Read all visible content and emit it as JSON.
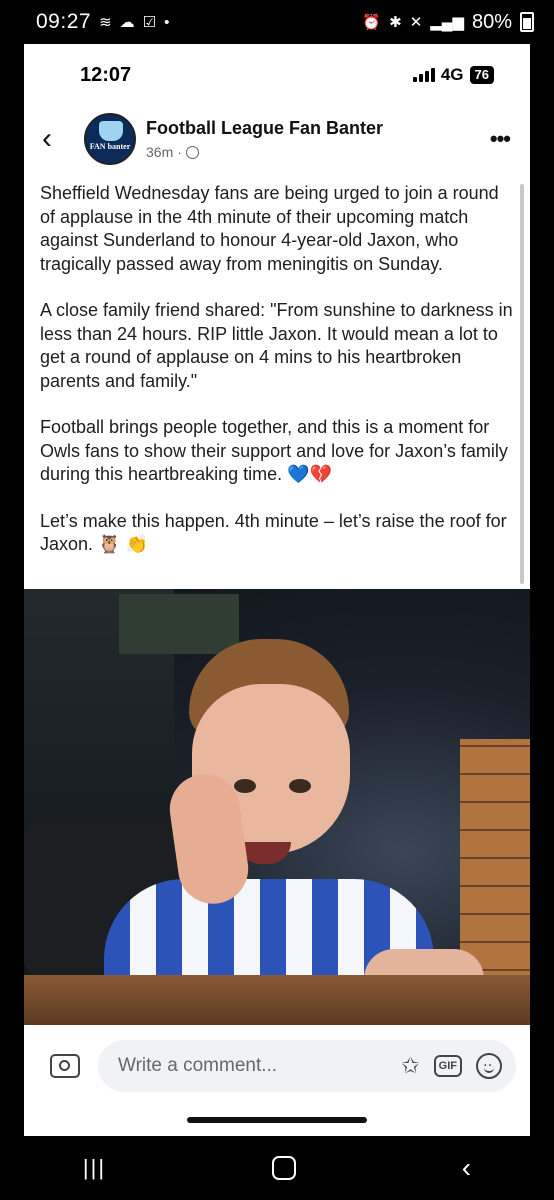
{
  "device_status": {
    "time": "09:27",
    "battery": "80%"
  },
  "inner_status": {
    "time": "12:07",
    "network": "4G",
    "battery": "76"
  },
  "post": {
    "page_name": "Football League Fan Banter",
    "time_ago": "36m",
    "separator": "·",
    "avatar_text": "FAN banter",
    "paragraphs": [
      "Sheffield Wednesday fans are being urged to join a round of applause in the 4th minute of their upcoming match against Sunderland to honour 4-year-old Jaxon, who tragically passed away from meningitis on Sunday.",
      "A close family friend shared: \"From sunshine to darkness in less than 24 hours. RIP little Jaxon. It would mean a lot to get a round of applause on 4 mins to his heartbroken parents and family.\"",
      "Football brings people together, and this is a moment for Owls fans to show their support and love for Jaxon’s family during this heartbreaking time. 💙💔",
      "Let’s make this happen. 4th minute – let’s raise the roof for Jaxon. 🦉 👏"
    ]
  },
  "comment_bar": {
    "placeholder": "Write a comment...",
    "gif_label": "GIF"
  },
  "icons": {
    "back": "chevron-left-icon",
    "more": "more-dots-icon",
    "camera": "camera-icon",
    "sticker": "sticker-icon",
    "gif": "gif-icon",
    "emoji": "emoji-icon"
  }
}
